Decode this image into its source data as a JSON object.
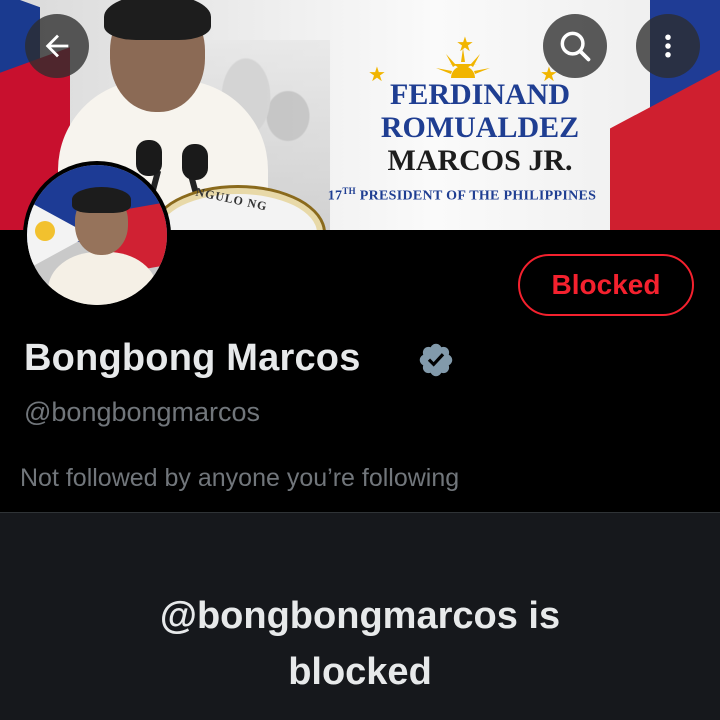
{
  "banner": {
    "headline_line1": "FERDINAND",
    "headline_line2": "ROMUALDEZ",
    "headline_line3": "MARCOS JR.",
    "subhead_number": "17",
    "subhead_suffix": "TH",
    "subhead_rest": " PRESIDENT OF THE PHILIPPINES",
    "seal_text": "NGULO NG"
  },
  "toolbar": {
    "back_icon": "arrow-left-icon",
    "search_icon": "search-icon",
    "more_icon": "more-vertical-icon"
  },
  "profile": {
    "display_name": "Bongbong Marcos",
    "handle": "@bongbongmarcos",
    "verified_icon": "verified-badge-icon",
    "followed_by_text": "Not followed by anyone you’re following",
    "blocked_button_label": "Blocked"
  },
  "blocked_notice": {
    "line1": "@bongbongmarcos is",
    "line2": "blocked"
  },
  "colors": {
    "background": "#000000",
    "lower_panel": "#16181c",
    "text_primary": "#e7e9ea",
    "text_secondary": "#71767b",
    "blocked_red": "#f4212e",
    "verified_badge": "#829aab"
  }
}
